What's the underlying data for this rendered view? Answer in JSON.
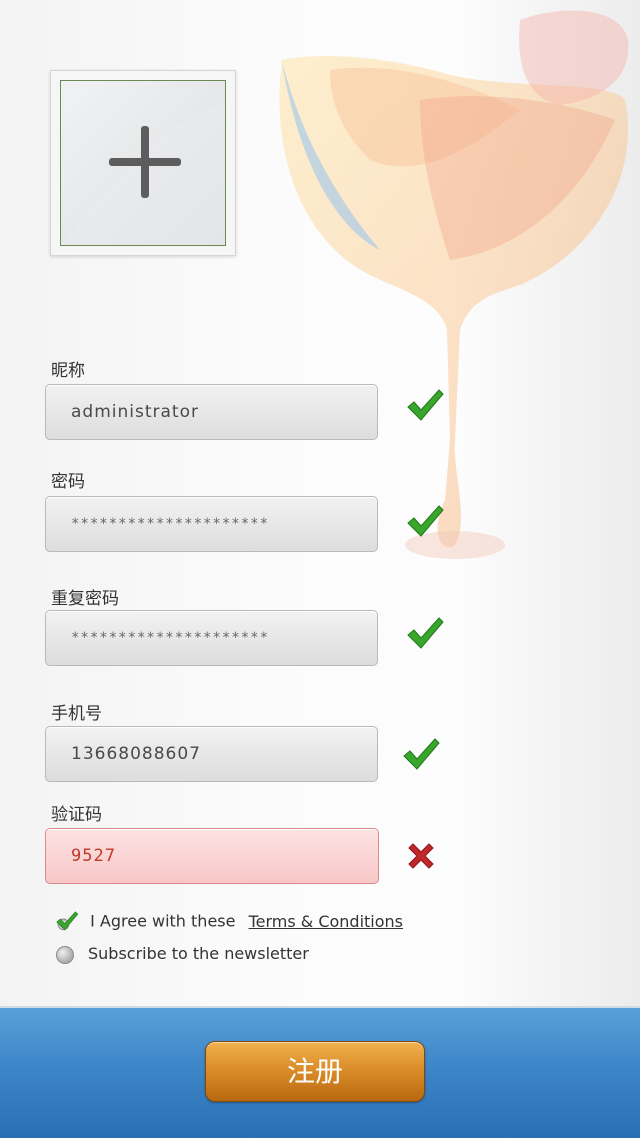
{
  "avatar": {
    "icon": "plus-icon"
  },
  "fields": [
    {
      "label": "昵称",
      "value": "administrator",
      "status": "valid"
    },
    {
      "label": "密码",
      "value": "*********************",
      "status": "valid"
    },
    {
      "label": "重复密码",
      "value": "*********************",
      "status": "valid"
    },
    {
      "label": "手机号",
      "value": "13668088607",
      "status": "valid"
    },
    {
      "label": "验证码",
      "value": "9527",
      "status": "invalid"
    }
  ],
  "agreement": {
    "text": "I Agree with these",
    "link": "Terms & Conditions",
    "checked": true
  },
  "newsletter": {
    "text": "Subscribe to the newsletter",
    "checked": false
  },
  "register_button": {
    "label": "注册"
  },
  "colors": {
    "valid": "#3aa52c",
    "invalid": "#c0282b",
    "button": "#d98a27",
    "bar": "#3d86c8"
  }
}
